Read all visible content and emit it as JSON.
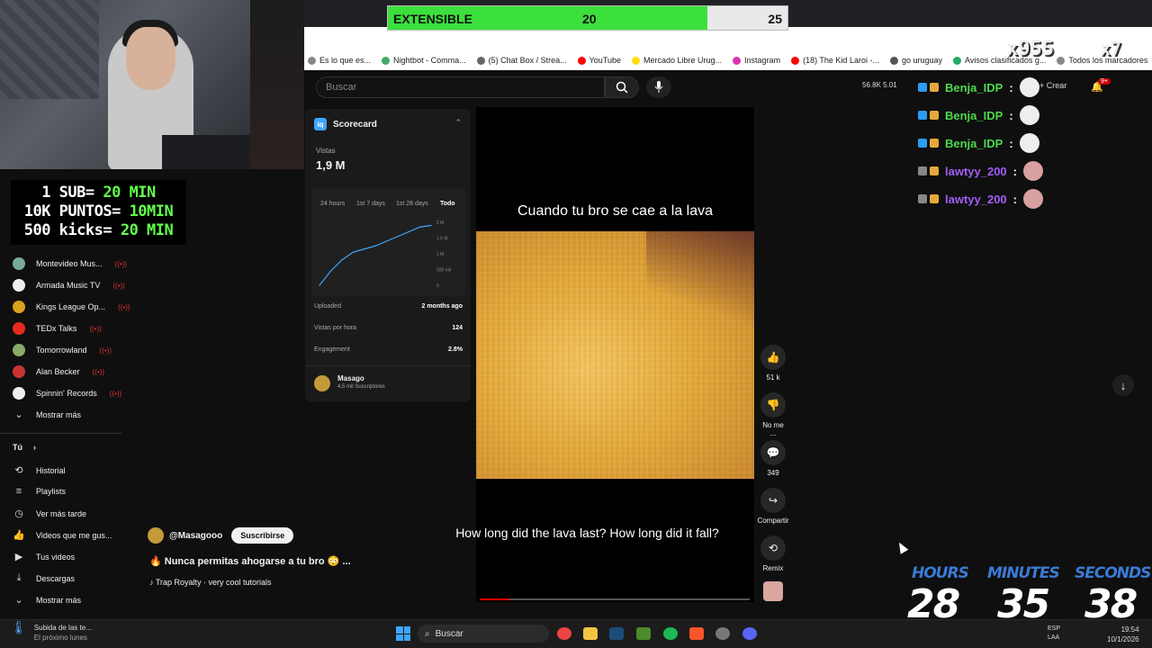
{
  "promo": {
    "line1_prefix": "1 SUB= ",
    "line1_value": "20 MIN",
    "line2_prefix": "10K PUNTOS= ",
    "line2_value": "10MIN",
    "line3_prefix": "500 kicks= ",
    "line3_value": "20 MIN"
  },
  "extensible": {
    "label": "EXTENSIBLE",
    "current": "20",
    "max": "25",
    "fraction": 0.8
  },
  "bookmarks": [
    {
      "label": "Es lo que es...",
      "color": "#888"
    },
    {
      "label": "Nightbot - Comma...",
      "color": "#4a6"
    },
    {
      "label": "(5) Chat Box / Strea...",
      "color": "#666"
    },
    {
      "label": "YouTube",
      "color": "#f00"
    },
    {
      "label": "Mercado Libre Urug...",
      "color": "#fd0"
    },
    {
      "label": "Instagram",
      "color": "#d3a"
    },
    {
      "label": "(18) The Kid Laroi -...",
      "color": "#f00"
    },
    {
      "label": "go uruguay",
      "color": "#555"
    },
    {
      "label": "Avisos clasificados g...",
      "color": "#2a6"
    },
    {
      "label": "Todos los marcadores",
      "color": "#888"
    }
  ],
  "search": {
    "placeholder": "Buscar"
  },
  "topright": {
    "stats": "56.8K  5.01",
    "crear": "Crear",
    "badge": "9+",
    "x955": "x955",
    "x7": "x7"
  },
  "subscriptions": [
    {
      "label": "Montevideo Mus...",
      "color": "#7a9"
    },
    {
      "label": "Armada Music TV",
      "color": "#eee"
    },
    {
      "label": "Kings League Op...",
      "color": "#d9a21b"
    },
    {
      "label": "TEDx Talks",
      "color": "#e62b1e"
    },
    {
      "label": "Tomorrowland",
      "color": "#8a6"
    },
    {
      "label": "Alan Becker",
      "color": "#c33"
    },
    {
      "label": "Spinnin' Records",
      "color": "#eee"
    }
  ],
  "nav": {
    "mostrar_mas": "Mostrar más",
    "tu": "Tú",
    "items": [
      "Historial",
      "Playlists",
      "Ver más tarde",
      "Videos que me gus...",
      "Tus videos",
      "Descargas",
      "Mostrar más"
    ]
  },
  "scorecard": {
    "title": "Scorecard",
    "views_label": "Vistas",
    "views_value": "1,9 M",
    "timeframes": [
      "24 hours",
      "1st 7 days",
      "1st 28 days",
      "Todo"
    ],
    "y_ticks": [
      "2 M",
      "1.5 M",
      "1 M",
      "500 mil",
      "0"
    ],
    "uploaded_label": "Uploaded",
    "uploaded_value": "2 months ago",
    "vph_label": "Vistas por hora",
    "vph_value": "124",
    "engagement_label": "Engagement",
    "engagement_value": "2.8%",
    "channel": "Masago",
    "subs": "4,5 mil Suscriptores"
  },
  "chart_data": {
    "type": "line",
    "x": [
      0,
      1,
      2,
      3,
      4,
      5,
      6,
      7,
      8,
      9,
      10
    ],
    "y": [
      0,
      0.45,
      0.8,
      1.05,
      1.15,
      1.25,
      1.4,
      1.55,
      1.7,
      1.85,
      1.9
    ],
    "ylim": [
      0,
      2
    ],
    "y_tick_labels": [
      "0",
      "500 mil",
      "1 M",
      "1.5 M",
      "2 M"
    ],
    "unit": "M"
  },
  "video": {
    "caption_top": "Cuando tu bro se cae a la lava",
    "caption_bottom": "How long did the lava last? How long did it fall?",
    "progress": 0.11
  },
  "actions": {
    "likes": "51 k",
    "dislike": "No me ...",
    "comments": "349",
    "share": "Compartir",
    "remix": "Remix"
  },
  "channel": {
    "handle": "@Masagooo",
    "subscribe": "Suscribirse"
  },
  "video_title": "Nunca permitas ahogarse a tu bro",
  "music": "Trap Royalty · very cool tutorials",
  "chat": [
    {
      "user": "Benja_IDP",
      "sep": ":",
      "color": "#4cd94c"
    },
    {
      "user": "Benja_IDP",
      "sep": ":",
      "color": "#4cd94c"
    },
    {
      "user": "Benja_IDP",
      "sep": ":",
      "color": "#4cd94c"
    },
    {
      "user": "lawtyy_200",
      "sep": ":",
      "color": "#a45cf7"
    },
    {
      "user": "lawtyy_200",
      "sep": ":",
      "color": "#a45cf7"
    }
  ],
  "timer": {
    "hours_label": "HOURS",
    "minutes_label": "MINUTES",
    "seconds_label": "SECONDS",
    "hours": "28",
    "minutes": "35",
    "seconds": "38"
  },
  "taskbar": {
    "weather_line1": "Subida de las te...",
    "weather_line2": "El próximo lunes",
    "search": "Buscar",
    "lang1": "ESP",
    "lang2": "LAA",
    "time": "19:54",
    "date": "10/1/2026"
  }
}
